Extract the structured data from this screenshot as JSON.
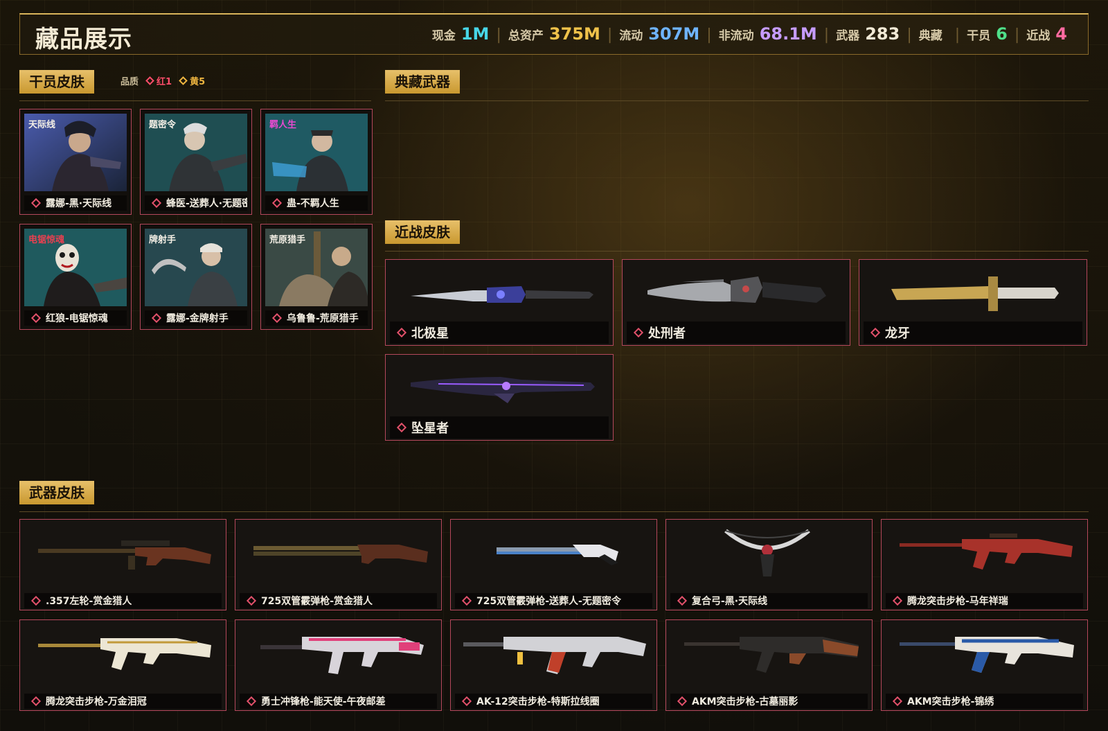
{
  "header": {
    "title": "藏品展示",
    "stats": [
      {
        "label": "现金",
        "value": "1M",
        "color": "#47d6e8"
      },
      {
        "label": "总资产",
        "value": "375M",
        "color": "#f0c24a"
      },
      {
        "label": "流动",
        "value": "307M",
        "color": "#6fb4ff"
      },
      {
        "label": "非流动",
        "value": "68.1M",
        "color": "#c69cff"
      },
      {
        "label": "武器",
        "value": "283",
        "color": "#f2ead6"
      },
      {
        "label": "典藏",
        "value": "",
        "color": "#f2ead6"
      },
      {
        "label": "干员",
        "value": "6",
        "color": "#4fe08a"
      },
      {
        "label": "近战",
        "value": "4",
        "color": "#ff6aa0"
      }
    ]
  },
  "operator_skins": {
    "title": "干员皮肤",
    "quality_label": "品质",
    "quality": [
      {
        "label": "红1",
        "color": "#ff4d6a"
      },
      {
        "label": "黄5",
        "color": "#f0b640"
      }
    ],
    "items": [
      {
        "name": "露娜-黑·天际线",
        "banner": "天际线",
        "bg": "#2a3a5a"
      },
      {
        "name": "蜂医-送葬人·无题密令",
        "banner": "题密令",
        "bg": "#1f4e52"
      },
      {
        "name": "蛊-不羁人生",
        "banner": "羁人生",
        "bg": "#1f5a63"
      },
      {
        "name": "红狼-电锯惊魂",
        "banner": "电锯惊魂",
        "bg": "#1f5a5e"
      },
      {
        "name": "露娜-金牌射手",
        "banner": "牌射手",
        "bg": "#27484f"
      },
      {
        "name": "乌鲁鲁-荒原猎手",
        "banner": "荒原猎手",
        "bg": "#3a4a45"
      }
    ]
  },
  "collection_weapons": {
    "title": "典藏武器"
  },
  "melee_skins": {
    "title": "近战皮肤",
    "items": [
      {
        "name": "北极星"
      },
      {
        "name": "处刑者"
      },
      {
        "name": "龙牙"
      },
      {
        "name": "坠星者"
      }
    ]
  },
  "weapon_skins": {
    "title": "武器皮肤",
    "items": [
      {
        "name": ".357左轮-赏金猎人"
      },
      {
        "name": "725双管霰弹枪-赏金猎人"
      },
      {
        "name": "725双管霰弹枪-送葬人-无题密令"
      },
      {
        "name": "复合弓-黑·天际线"
      },
      {
        "name": "腾龙突击步枪-马年祥瑞"
      },
      {
        "name": "腾龙突击步枪-万金泪冠"
      },
      {
        "name": "勇士冲锋枪-能天使-午夜邮差"
      },
      {
        "name": "AK-12突击步枪-特斯拉线圈"
      },
      {
        "name": "AKM突击步枪-古墓丽影"
      },
      {
        "name": "AKM突击步枪-锦绣"
      }
    ]
  }
}
